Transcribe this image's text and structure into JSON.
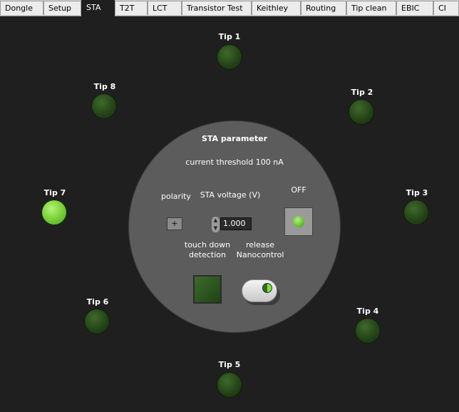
{
  "tabs": [
    {
      "label": "Dongle",
      "active": false
    },
    {
      "label": "Setup",
      "active": false
    },
    {
      "label": "STA",
      "active": true
    },
    {
      "label": "T2T",
      "active": false
    },
    {
      "label": "LCT",
      "active": false
    },
    {
      "label": "Transistor Test",
      "active": false
    },
    {
      "label": "Keithley",
      "active": false
    },
    {
      "label": "Routing",
      "active": false
    },
    {
      "label": "Tip clean",
      "active": false
    },
    {
      "label": "EBIC",
      "active": false
    },
    {
      "label": "CI",
      "active": false
    }
  ],
  "tips": [
    {
      "label": "Tip 1",
      "on": false
    },
    {
      "label": "Tip 2",
      "on": false
    },
    {
      "label": "Tip 3",
      "on": false
    },
    {
      "label": "Tip 4",
      "on": false
    },
    {
      "label": "Tip 5",
      "on": false
    },
    {
      "label": "Tip 6",
      "on": false
    },
    {
      "label": "Tip 7",
      "on": true
    },
    {
      "label": "Tip 8",
      "on": false
    }
  ],
  "sta": {
    "title": "STA parameter",
    "threshold": "current threshold 100 nA",
    "polarity_label": "polarity",
    "polarity_value": "+",
    "voltage_label": "STA voltage (V)",
    "voltage_value": "1.000",
    "off_label": "OFF",
    "touch_label_line1": "touch down",
    "touch_label_line2": "detection",
    "release_label_line1": "release",
    "release_label_line2": "Nanocontrol"
  },
  "colors": {
    "background": "#1f1f1f",
    "circle": "#5c5c5c",
    "led_off": "#244217",
    "led_on": "#7ad43a"
  }
}
